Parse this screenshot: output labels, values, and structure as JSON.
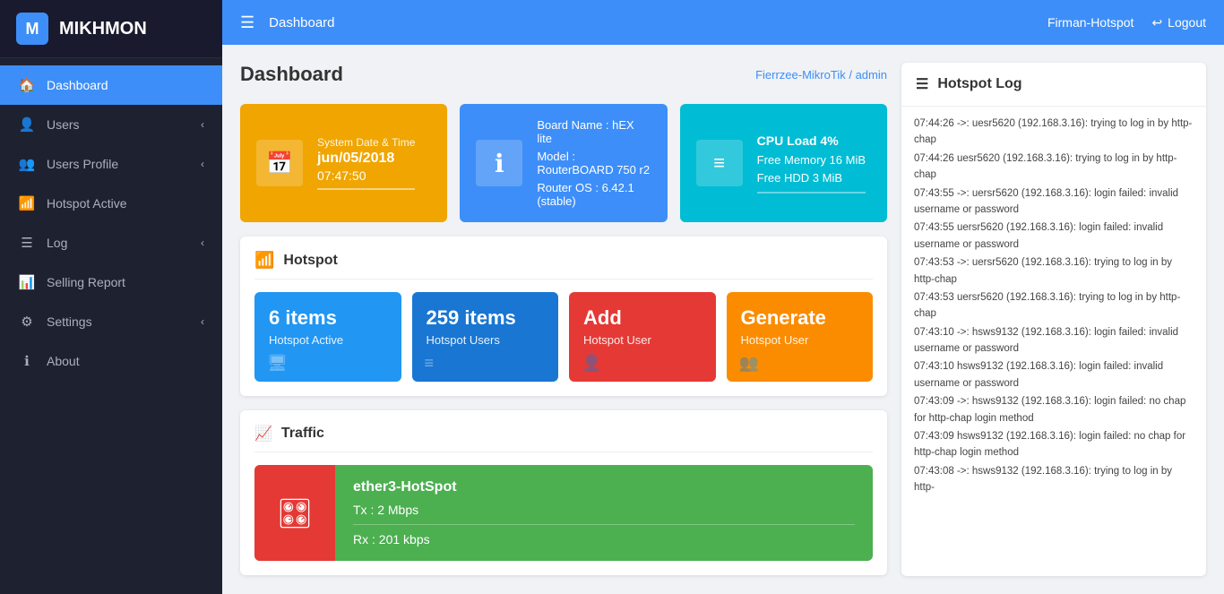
{
  "app": {
    "name": "MIKHMON",
    "logo_icon": "M"
  },
  "topbar": {
    "menu_icon": "☰",
    "page_title": "Dashboard",
    "user": "Firman-Hotspot",
    "logout_label": "Logout"
  },
  "page_header": {
    "title": "Dashboard",
    "breadcrumb_server": "Fierrzee-MikroTik",
    "breadcrumb_separator": "/",
    "breadcrumb_user": "admin"
  },
  "info_cards": [
    {
      "type": "yellow",
      "label": "System Date & Time",
      "date": "jun/05/2018",
      "time": "07:47:50",
      "icon": "📅"
    },
    {
      "type": "blue",
      "board_name": "Board Name : hEX lite",
      "model": "Model : RouterBOARD 750 r2",
      "router_os": "Router OS : 6.42.1 (stable)",
      "icon": "ℹ"
    },
    {
      "type": "teal",
      "cpu": "CPU Load 4%",
      "memory": "Free Memory 16 MiB",
      "hdd": "Free HDD 3 MiB",
      "icon": "≡"
    }
  ],
  "hotspot_section": {
    "title": "Hotspot",
    "wifi_icon": "📶",
    "cards": [
      {
        "count": "6 items",
        "label": "Hotspot Active",
        "color": "blue-dark",
        "bottom_icon": "🖥"
      },
      {
        "count": "259 items",
        "label": "Hotspot Users",
        "color": "blue-mid",
        "bottom_icon": "≡"
      },
      {
        "count": "Add",
        "label": "Hotspot User",
        "color": "red",
        "bottom_icon": "👤"
      },
      {
        "count": "Generate",
        "label": "Hotspot User",
        "color": "orange",
        "bottom_icon": "👥"
      }
    ]
  },
  "traffic_section": {
    "title": "Traffic",
    "interface": "ether3-HotSpot",
    "tx": "Tx : 2 Mbps",
    "rx": "Rx : 201 kbps",
    "icon": "🎛"
  },
  "hotspot_log": {
    "title": "Hotspot Log",
    "entries": [
      "07:44:26 ->: uesr5620 (192.168.3.16): trying to log in by http-chap",
      "07:44:26 uesr5620 (192.168.3.16): trying to log in by http-chap",
      "07:43:55 ->: uersr5620 (192.168.3.16): login failed: invalid username or password",
      "07:43:55 uersr5620 (192.168.3.16): login failed: invalid username or password",
      "07:43:53 ->: uersr5620 (192.168.3.16): trying to log in by http-chap",
      "07:43:53 uersr5620 (192.168.3.16): trying to log in by http-chap",
      "07:43:10 ->: hsws9132 (192.168.3.16): login failed: invalid username or password",
      "07:43:10 hsws9132 (192.168.3.16): login failed: invalid username or password",
      "07:43:09 ->: hsws9132 (192.168.3.16): login failed: no chap for http-chap login method",
      "07:43:09 hsws9132 (192.168.3.16): login failed: no chap for http-chap login method",
      "07:43:08 ->: hsws9132 (192.168.3.16): trying to log in by http-"
    ]
  },
  "sidebar": {
    "items": [
      {
        "label": "Dashboard",
        "icon": "🏠",
        "active": true,
        "arrow": false
      },
      {
        "label": "Users",
        "icon": "👤",
        "active": false,
        "arrow": true
      },
      {
        "label": "Users Profile",
        "icon": "👥",
        "active": false,
        "arrow": true
      },
      {
        "label": "Hotspot Active",
        "icon": "📶",
        "active": false,
        "arrow": false
      },
      {
        "label": "Log",
        "icon": "☰",
        "active": false,
        "arrow": true
      },
      {
        "label": "Selling Report",
        "icon": "📊",
        "active": false,
        "arrow": false
      },
      {
        "label": "Settings",
        "icon": "⚙",
        "active": false,
        "arrow": true
      },
      {
        "label": "About",
        "icon": "ℹ",
        "active": false,
        "arrow": false
      }
    ]
  }
}
